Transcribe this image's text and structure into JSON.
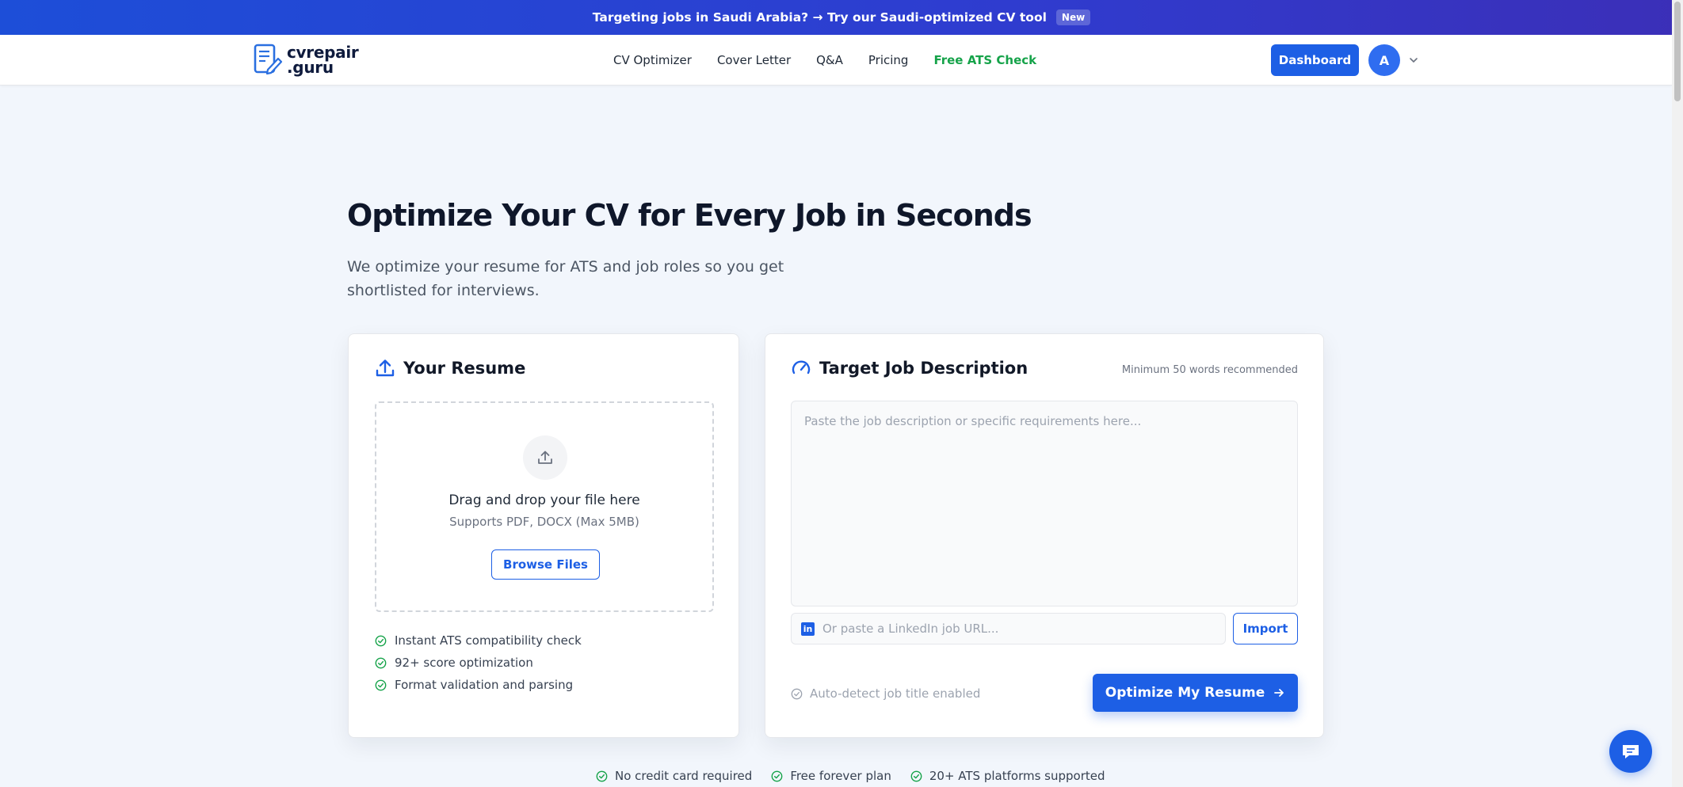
{
  "announcement": {
    "text": "Targeting jobs in Saudi Arabia? → Try our Saudi-optimized CV tool",
    "badge": "New"
  },
  "header": {
    "logo_line1": "cvrepair",
    "logo_line2": ".guru",
    "nav": [
      "CV Optimizer",
      "Cover Letter",
      "Q&A",
      "Pricing",
      "Free ATS Check"
    ],
    "dashboard_label": "Dashboard",
    "avatar_initial": "A"
  },
  "hero": {
    "title": "Optimize Your CV for Every Job in Seconds",
    "subtitle": "We optimize your resume for ATS and job roles so you get shortlisted for interviews."
  },
  "resume_card": {
    "title": "Your Resume",
    "drop_title": "Drag and drop your file here",
    "drop_sub": "Supports PDF, DOCX (Max 5MB)",
    "browse_label": "Browse Files",
    "features": [
      "Instant ATS compatibility check",
      "92+ score optimization",
      "Format validation and parsing"
    ]
  },
  "job_card": {
    "title": "Target Job Description",
    "min_note": "Minimum 50 words recommended",
    "textarea_placeholder": "Paste the job description or specific requirements here...",
    "linkedin_placeholder": "Or paste a LinkedIn job URL...",
    "import_label": "Import",
    "autodetect_label": "Auto-detect job title enabled",
    "optimize_label": "Optimize My Resume"
  },
  "trust": [
    "No credit card required",
    "Free forever plan",
    "20+ ATS platforms supported"
  ],
  "colors": {
    "primary": "#1d5fe5",
    "success": "#16a34a",
    "background": "#f2f6fc"
  }
}
